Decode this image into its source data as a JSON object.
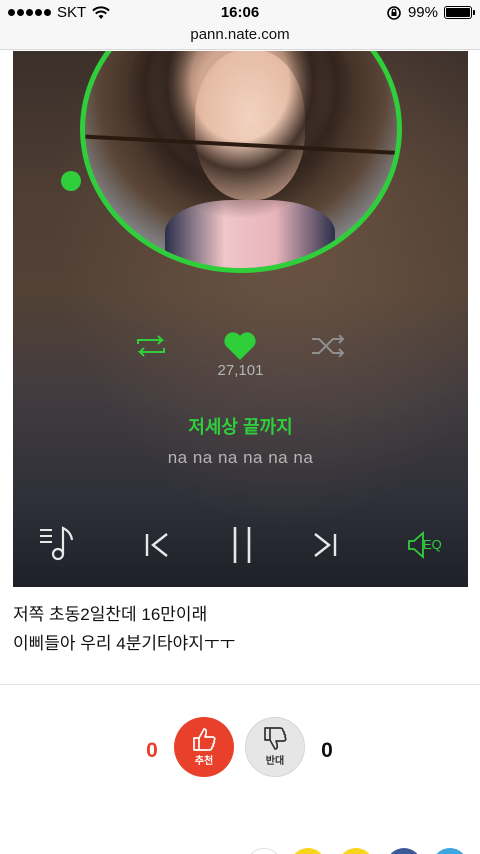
{
  "status_bar": {
    "carrier": "SKT",
    "time": "16:06",
    "battery_percent": "99%",
    "battery_level": 0.99
  },
  "address_bar": {
    "url": "pann.nate.com"
  },
  "player": {
    "like_count": "27,101",
    "song_title": "저세상 끝까지",
    "lyric": "na na na na na na",
    "eq_label": "EQ",
    "accent_color": "#2fcf3b"
  },
  "caption": {
    "line1": "저쪽 초동2일찬데 16만이래",
    "line2": "이삐들아 우리 4분기타야지ㅜㅜ"
  },
  "votes": {
    "up_count": "0",
    "up_label": "추천",
    "down_count": "0",
    "down_label": "반대"
  }
}
